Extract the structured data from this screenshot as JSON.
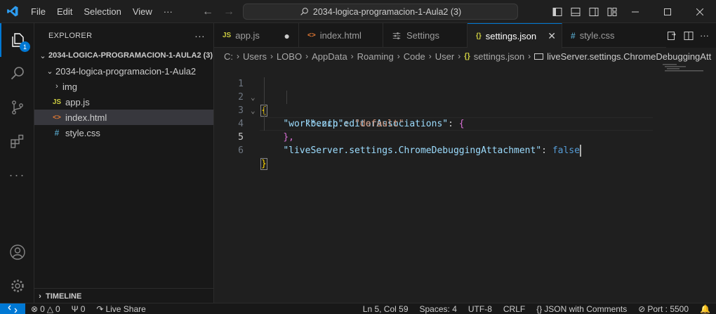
{
  "titlebar": {
    "menu": [
      "File",
      "Edit",
      "Selection",
      "View",
      "···"
    ],
    "command_center": "2034-logica-programacion-1-Aula2 (3)"
  },
  "activity": {
    "explorer_badge": "1"
  },
  "sidebar": {
    "title": "EXPLORER",
    "more": "···",
    "root": "2034-LOGICA-PROGRAMACION-1-AULA2 (3)",
    "folder": "2034-logica-programacion-1-Aula2",
    "items": [
      {
        "label": "img",
        "icon": "folder-chevron"
      },
      {
        "label": "app.js",
        "icon": "JS"
      },
      {
        "label": "index.html",
        "icon": "<>"
      },
      {
        "label": "style.css",
        "icon": "#"
      }
    ],
    "timeline": "TIMELINE"
  },
  "tabs": [
    {
      "label": "app.js",
      "icon": "JS"
    },
    {
      "label": "index.html",
      "icon": "<>"
    },
    {
      "label": "Settings",
      "icon": "settings-icon"
    },
    {
      "label": "settings.json",
      "icon": "{}"
    },
    {
      "label": "style.css",
      "icon": "#"
    }
  ],
  "breadcrumb": [
    "C:",
    "Users",
    "LOBO",
    "AppData",
    "Roaming",
    "Code",
    "User",
    "settings.json",
    "liveServer.settings.ChromeDebuggingAtt"
  ],
  "code": {
    "lines": [
      "1",
      "2",
      "3",
      "4",
      "5",
      "6"
    ],
    "l1": "{",
    "l2_key": "\"workbench.editorAssociations\"",
    "l2_colon": ": ",
    "l2_brace": "{",
    "l3_key": "\"*.zip\"",
    "l3_colon": ": ",
    "l3_val": "\"default\"",
    "l4": "},",
    "l5_key": "\"liveServer.settings.ChromeDebuggingAttachment\"",
    "l5_colon": ": ",
    "l5_val": "false",
    "l6": "}"
  },
  "status": {
    "problems": "0",
    "warnings": "0",
    "ports": "0",
    "live_share": "Live Share",
    "position": "Ln 5, Col 59",
    "spaces": "Spaces: 4",
    "encoding": "UTF-8",
    "eol": "CRLF",
    "language": "JSON with Comments",
    "port": "Port : 5500"
  },
  "colors": {
    "accent": "#0078d4",
    "key": "#9cdcfe",
    "string": "#ce9178",
    "keyword": "#569cd6"
  }
}
